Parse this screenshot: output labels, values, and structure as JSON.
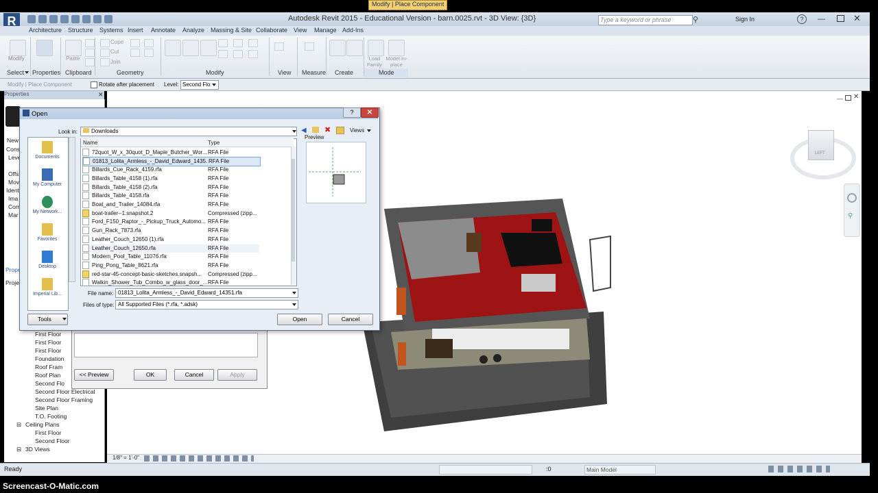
{
  "app": {
    "title": "Autodesk Revit 2015 - Educational Version -     barn.0025.rvt - 3D View: {3D}",
    "logo": "R",
    "search_placeholder": "Type a keyword or phrase",
    "sign_in": "Sign In"
  },
  "tabs": [
    "Architecture",
    "Structure",
    "Systems",
    "Insert",
    "Annotate",
    "Analyze",
    "Massing & Site",
    "Collaborate",
    "View",
    "Manage",
    "Add-Ins",
    "Modify | Place Component"
  ],
  "ribbon": {
    "panels": [
      "Select",
      "Properties",
      "Clipboard",
      "Geometry",
      "Modify",
      "View",
      "Measure",
      "Create",
      "Mode"
    ],
    "modify_label": "Modify",
    "properties_label": "Properties",
    "paste_label": "Paste",
    "cope": "Cope",
    "cut": "Cut",
    "join": "Join",
    "load_family": "Load Family",
    "model_inplace": "Model In-place"
  },
  "optbar": {
    "context": "Modify | Place Component",
    "rotate": "Rotate after placement",
    "level_label": "Level:",
    "level_value": "Second Flo"
  },
  "left": {
    "properties_header": "Properties",
    "side_labels": [
      "New",
      "Cons",
      "Leve",
      "Offs",
      "Mov",
      "Ident",
      "Ima",
      "Com",
      "Mar"
    ],
    "properties_link": "Prope",
    "project_label": "Proje",
    "tree": [
      "First Floor",
      "First Floor",
      "First Floor",
      "Foundation",
      "Roof Fram",
      "Roof Plan",
      "Second Flo",
      "Second Flo",
      "Second Floor Electrical",
      "Second Floor Framing",
      "Site Plan",
      "T.O. Footing",
      "Ceiling Plans",
      "First Floor",
      "Second Floor",
      "3D Views"
    ]
  },
  "behind_dialog": {
    "prev": "<< Preview",
    "ok": "OK",
    "cancel": "Cancel",
    "apply": "Apply"
  },
  "dialog": {
    "title": "Open",
    "look_in_label": "Look in:",
    "look_in_value": "Downloads",
    "views_label": "Views",
    "preview_label": "Preview",
    "col_name": "Name",
    "col_type": "Type",
    "files": [
      {
        "name": "72quot_W_x_30quot_D_Maple_Butcher_Wor...",
        "type": "RFA File",
        "zip": false
      },
      {
        "name": "01813_Lolita_Armless_-_David_Edward_1435...",
        "type": "RFA File",
        "zip": false
      },
      {
        "name": "Billards_Cue_Rack_4159.rfa",
        "type": "RFA File",
        "zip": false
      },
      {
        "name": "Billards_Table_4158 (1).rfa",
        "type": "RFA File",
        "zip": false
      },
      {
        "name": "Billards_Table_4158 (2).rfa",
        "type": "RFA File",
        "zip": false
      },
      {
        "name": "Billards_Table_4158.rfa",
        "type": "RFA File",
        "zip": false
      },
      {
        "name": "Boat_and_Trailer_14084.rfa",
        "type": "RFA File",
        "zip": false
      },
      {
        "name": "boat-trailer--1.snapshot.2",
        "type": "Compressed (zipp...",
        "zip": true
      },
      {
        "name": "Ford_F150_Raptor_-_Pickup_Truck_Automo...",
        "type": "RFA File",
        "zip": false
      },
      {
        "name": "Gun_Rack_7873.rfa",
        "type": "RFA File",
        "zip": false
      },
      {
        "name": "Leather_Couch_12650 (1).rfa",
        "type": "RFA File",
        "zip": false
      },
      {
        "name": "Leather_Couch_12650.rfa",
        "type": "RFA File",
        "zip": false
      },
      {
        "name": "Modern_Pool_Table_11076.rfa",
        "type": "RFA File",
        "zip": false
      },
      {
        "name": "Ping_Pong_Table_8621.rfa",
        "type": "RFA File",
        "zip": false
      },
      {
        "name": "red-star-45-concept-basic-sketches.snapsh...",
        "type": "Compressed (zipp...",
        "zip": true
      },
      {
        "name": "Walkin_Shower_Tub_Combo_w_glass_door_...",
        "type": "RFA File",
        "zip": false
      }
    ],
    "places": [
      "Documents",
      "My Computer",
      "My Network...",
      "Favorites",
      "Desktop",
      "Imperial Lib..."
    ],
    "file_name_label": "File name:",
    "file_name_value": "01813_Lolita_Armless_-_David_Edward_14351.rfa",
    "files_of_type_label": "Files of type:",
    "files_of_type_value": "All Supported Files  (*.rfa, *.adsk)",
    "tools": "Tools",
    "open": "Open",
    "cancel": "Cancel"
  },
  "viewbar": {
    "scale": "1/8\" = 1'-0\""
  },
  "status": {
    "ready": "Ready",
    "zero": ":0",
    "model": "Main Model"
  },
  "viewcube": {
    "face": "LEFT"
  },
  "watermark": "Screencast-O-Matic.com"
}
